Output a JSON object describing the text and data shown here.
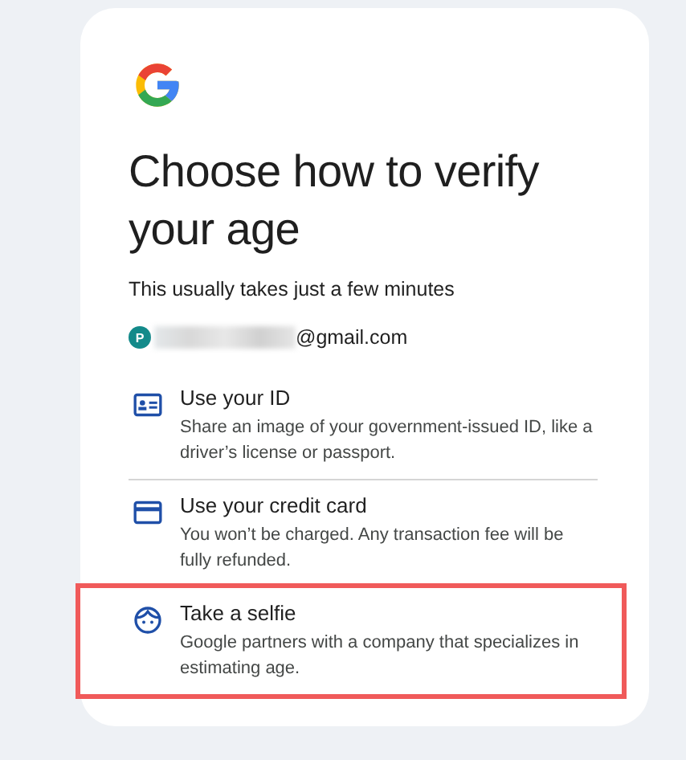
{
  "title": "Choose how to verify your age",
  "subtitle": "This usually takes just a few minutes",
  "account": {
    "initial": "P",
    "email": "@gmail.com",
    "redacted": true
  },
  "options": [
    {
      "kind": "id",
      "title": "Use your ID",
      "description": "Share an image of your government-issued ID, like a driver’s license or passport.",
      "highlighted": false
    },
    {
      "kind": "card",
      "title": "Use your credit card",
      "description": "You won’t be charged. Any transaction fee will be fully refunded.",
      "highlighted": false
    },
    {
      "kind": "selfie",
      "title": "Take a selfie",
      "description": "Google partners with a company that specializes in estimating age.",
      "highlighted": true
    }
  ]
}
